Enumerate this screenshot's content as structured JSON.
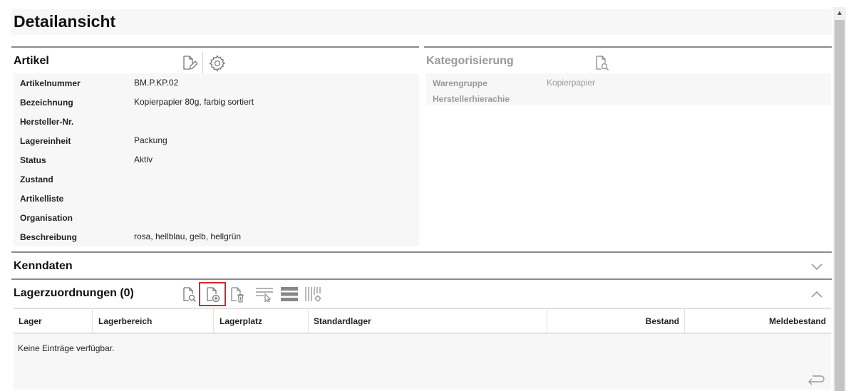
{
  "page": {
    "title": "Detailansicht"
  },
  "artikel": {
    "title": "Artikel",
    "icons": [
      "edit-document-icon",
      "gear-icon"
    ],
    "fields": [
      {
        "label": "Artikelnummer",
        "value": "BM.P.KP.02"
      },
      {
        "label": "Bezeichnung",
        "value": "Kopierpapier 80g, farbig sortiert"
      },
      {
        "label": "Hersteller-Nr.",
        "value": ""
      },
      {
        "label": "Lagereinheit",
        "value": "Packung"
      },
      {
        "label": "Status",
        "value": "Aktiv"
      },
      {
        "label": "Zustand",
        "value": ""
      },
      {
        "label": "Artikelliste",
        "value": ""
      },
      {
        "label": "Organisation",
        "value": ""
      },
      {
        "label": "Beschreibung",
        "value": "rosa, hellblau, gelb, hellgrün"
      }
    ]
  },
  "kategorisierung": {
    "title": "Kategorisierung",
    "icons": [
      "search-document-icon"
    ],
    "fields": [
      {
        "label": "Warengruppe",
        "value": "Kopierpapier"
      },
      {
        "label": "Herstellerhierachie",
        "value": ""
      }
    ]
  },
  "kenndaten": {
    "title": "Kenndaten",
    "state": "collapsed"
  },
  "lagerzuordnungen": {
    "title": "Lagerzuordnungen (0)",
    "state": "expanded",
    "icons": [
      "search-document-icon",
      "add-document-icon",
      "delete-document-icon",
      "filter-select-icon",
      "list-view-icon",
      "column-settings-icon"
    ],
    "columns": [
      "Lager",
      "Lagerbereich",
      "Lagerplatz",
      "Standardlager",
      "Bestand",
      "Meldebestand"
    ],
    "empty_text": "Keine Einträge verfügbar."
  },
  "colors": {
    "highlight": "#d9262b",
    "divider": "#8a8a8a",
    "panel": "#f7f7f7",
    "muted": "#999999"
  }
}
